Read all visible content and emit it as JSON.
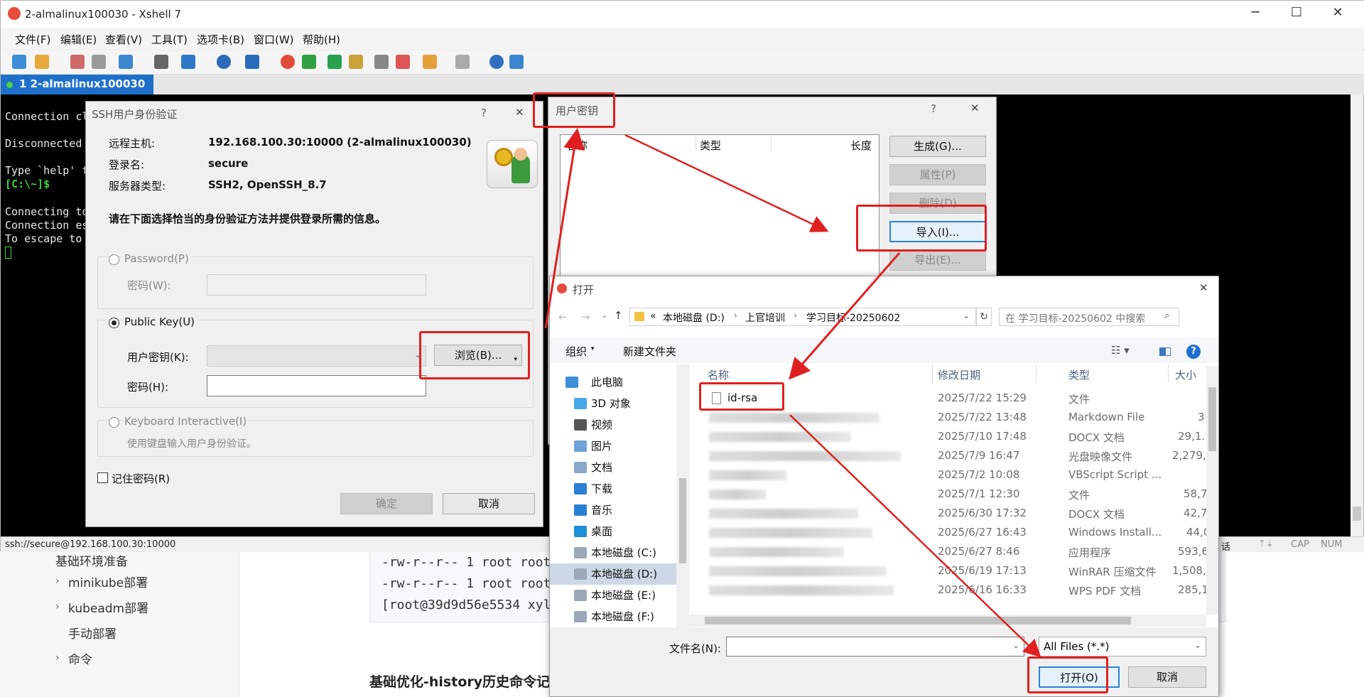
{
  "background_page": {
    "sidebar_items": [
      "基础环境准备",
      "minikube部署",
      "kubeadm部署",
      "手动部署",
      "命令"
    ],
    "code_lines": [
      "-rw-r--r-- 1 root root",
      "-rw-r--r-- 1 root root",
      "[root@39d9d56e5534 xyl"
    ],
    "heading": "基础优化-history历史命令记"
  },
  "xshell": {
    "title": "2-almalinux100030 - Xshell 7",
    "menu": [
      "文件(F)",
      "编辑(E)",
      "查看(V)",
      "工具(T)",
      "选项卡(B)",
      "窗口(W)",
      "帮助(H)"
    ],
    "tab_label": "1 2-almalinux100030",
    "terminal_lines": [
      "Connection cl",
      "",
      "Disconnected ",
      "",
      "Type `help' t",
      "[C:\\~]$",
      "",
      "Connecting to",
      "Connection es",
      "To escape to"
    ],
    "status": {
      "url": "ssh://secure@192.168.100.30:10000",
      "right_text": "话",
      "cap": "CAP",
      "num": "NUM"
    }
  },
  "ssh_dialog": {
    "title": "SSH用户身份验证",
    "help": "?",
    "close": "✕",
    "remote_host_label": "远程主机:",
    "remote_host_value": "192.168.100.30:10000 (2-almalinux100030)",
    "login_label": "登录名:",
    "login_value": "secure",
    "server_type_label": "服务器类型:",
    "server_type_value": "SSH2, OpenSSH_8.7",
    "instruction": "请在下面选择恰当的身份验证方法并提供登录所需的信息。",
    "password_option": "Password(P)",
    "password_field_label": "密码(W):",
    "pubkey_option": "Public Key(U)",
    "user_key_label": "用户密钥(K):",
    "browse_button": "浏览(B)...",
    "passphrase_label": "密码(H):",
    "keyboard_option": "Keyboard Interactive(I)",
    "keyboard_desc": "使用键盘输入用户身份验证。",
    "remember_label": "记住密码(R)",
    "ok_button": "确定",
    "cancel_button": "取消"
  },
  "key_dialog": {
    "title": "用户密钥",
    "help": "?",
    "close": "✕",
    "columns": [
      "名称",
      "类型",
      "长度"
    ],
    "buttons": [
      "生成(G)...",
      "属性(P)",
      "删除(D)",
      "导入(I)...",
      "导出(E)..."
    ]
  },
  "open_dialog": {
    "title": "打开",
    "close": "✕",
    "path": [
      "«",
      "本地磁盘 (D:)",
      "上官培训",
      "学习目标-20250602"
    ],
    "search_placeholder": "在 学习目标-20250602 中搜索",
    "organize": "组织",
    "new_folder": "新建文件夹",
    "nav": [
      "此电脑",
      "3D 对象",
      "视频",
      "图片",
      "文档",
      "下载",
      "音乐",
      "桌面",
      "本地磁盘 (C:)",
      "本地磁盘 (D:)",
      "本地磁盘 (E:)",
      "本地磁盘 (F:)"
    ],
    "columns": [
      "名称",
      "修改日期",
      "类型",
      "大小"
    ],
    "files": [
      {
        "name": "id-rsa",
        "date": "2025/7/22 15:29",
        "type": "文件",
        "size": ""
      },
      {
        "name": "",
        "date": "2025/7/22 13:48",
        "type": "Markdown File",
        "size": "3"
      },
      {
        "name": "",
        "date": "2025/7/10 17:48",
        "type": "DOCX 文档",
        "size": "29,1."
      },
      {
        "name": "",
        "date": "2025/7/9 16:47",
        "type": "光盘映像文件",
        "size": "2,279,"
      },
      {
        "name": "",
        "date": "2025/7/2 10:08",
        "type": "VBScript Script ...",
        "size": ""
      },
      {
        "name": "",
        "date": "2025/7/1 12:30",
        "type": "文件",
        "size": "58,7."
      },
      {
        "name": "",
        "date": "2025/6/30 17:32",
        "type": "DOCX 文档",
        "size": "42,7."
      },
      {
        "name": "",
        "date": "2025/6/27 16:43",
        "type": "Windows Install...",
        "size": "44,0"
      },
      {
        "name": "",
        "date": "2025/6/27 8:46",
        "type": "应用程序",
        "size": "593,6"
      },
      {
        "name": "",
        "date": "2025/6/19 17:13",
        "type": "WinRAR 压缩文件",
        "size": "1,508,"
      },
      {
        "name": "",
        "date": "2025/6/16 16:33",
        "type": "WPS PDF 文档",
        "size": "285,1."
      }
    ],
    "filename_label": "文件名(N):",
    "filetype": "All Files (*.*)",
    "open_button": "打开(O)",
    "cancel_button": "取消"
  },
  "colors": {
    "accent": "#1e6fc9",
    "annotation": "#e02020",
    "terminal_bg": "#000000",
    "prompt": "#3fd23f"
  }
}
